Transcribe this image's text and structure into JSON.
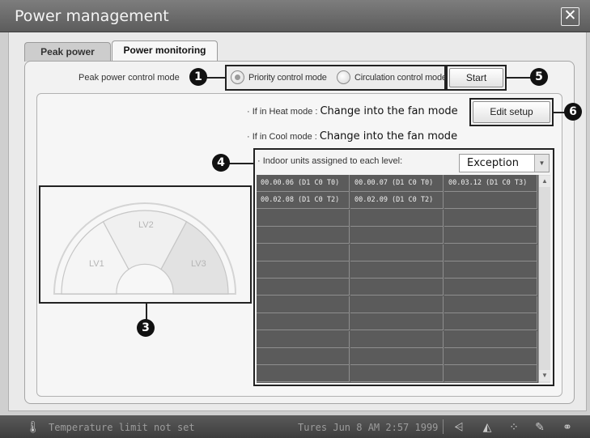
{
  "window": {
    "title": "Power management",
    "close_icon": "close-icon"
  },
  "tabs": [
    {
      "label": "Peak power",
      "active": false
    },
    {
      "label": "Power monitoring",
      "active": true
    }
  ],
  "control": {
    "mode_label": "Peak power control mode",
    "options": [
      {
        "label": "Priority control mode",
        "checked": true
      },
      {
        "label": "Circulation control mode",
        "checked": false
      }
    ],
    "start_label": "Start"
  },
  "info": {
    "heat_prefix": "· If in Heat mode : ",
    "heat_value": "Change into the fan mode",
    "cool_prefix": "· If in Cool mode : ",
    "cool_value": "Change into the fan mode",
    "edit_label": "Edit setup"
  },
  "units": {
    "label": "· Indoor units assigned to each level:",
    "selected": "Exception",
    "rows": [
      [
        "00.00.06 (D1 C0 T0)",
        "00.00.07 (D1 C0 T0)",
        "00.03.12 (D1 C0 T3)"
      ],
      [
        "00.02.08 (D1 C0 T2)",
        "00.02.09 (D1 C0 T2)",
        ""
      ]
    ],
    "total_rows": 12
  },
  "gauge": {
    "levels": [
      {
        "label": "LV1",
        "color": "#f5f5f5"
      },
      {
        "label": "LV2",
        "color": "#f0f0f0"
      },
      {
        "label": "LV3",
        "color": "#e2e2e2"
      }
    ]
  },
  "callouts": [
    "1",
    "3",
    "4",
    "5",
    "6"
  ],
  "status": {
    "message": "Temperature limit not set",
    "datetime": "Tures Jun 8 AM 2:57 1999"
  },
  "colors": {
    "titlebar": "#6c6c6c",
    "grid": "#5b5b5b",
    "statusbar": "#4a4a4a"
  }
}
